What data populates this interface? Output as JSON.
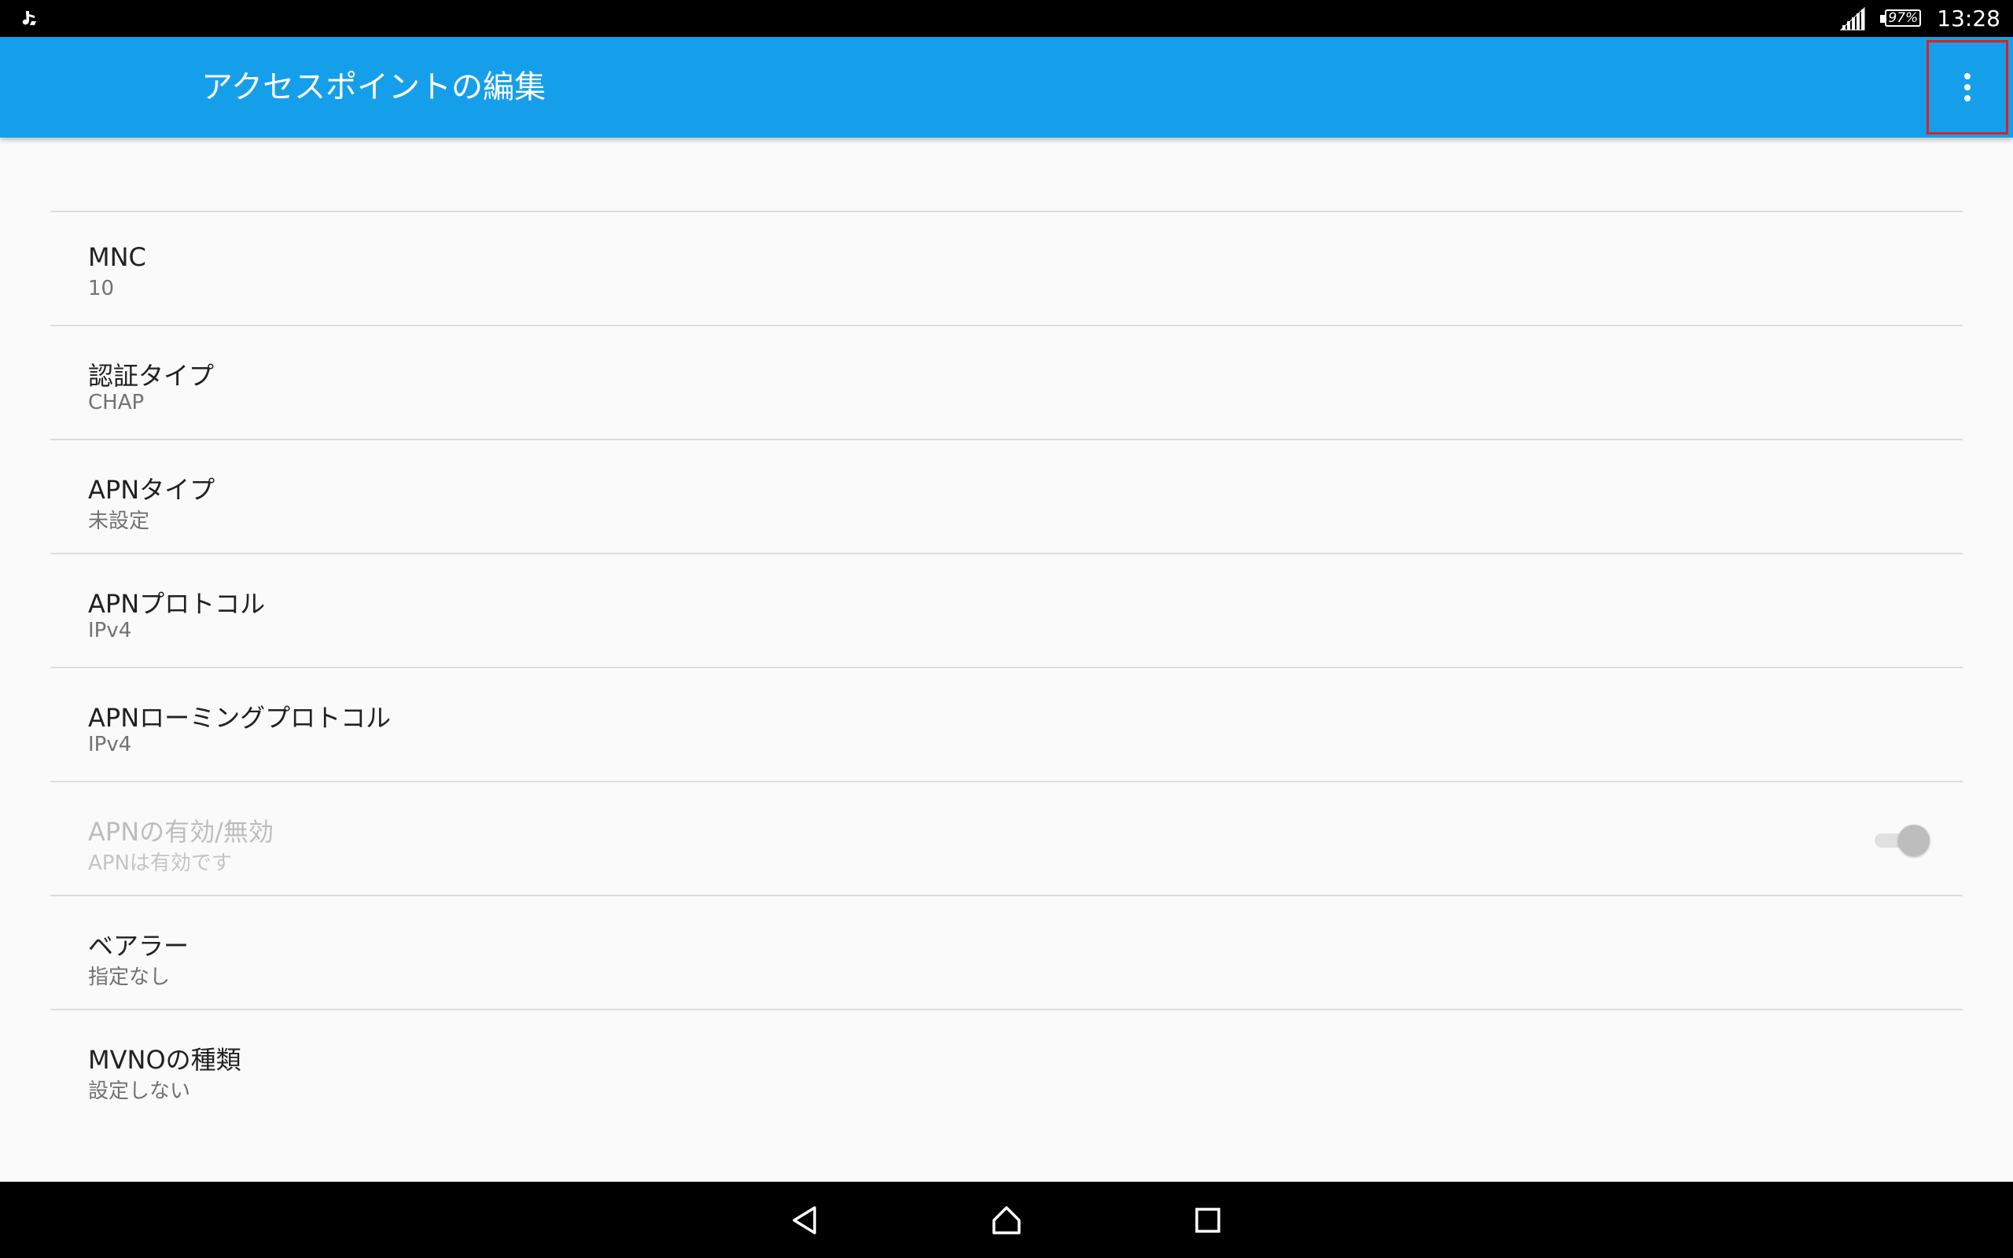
{
  "status_bar": {
    "left_icon": "notification-app-icon",
    "battery_percent": "97%",
    "time": "13:28",
    "signal_icon": "cell-signal-icon"
  },
  "app_bar": {
    "title": "アクセスポイントの編集",
    "overflow_icon": "more-vert-icon",
    "background_color": "#159fea"
  },
  "preferences": [
    {
      "title": "MNC",
      "summary": "10"
    },
    {
      "title": "認証タイプ",
      "summary": "CHAP"
    },
    {
      "title": "APNタイプ",
      "summary": "未設定"
    },
    {
      "title": "APNプロトコル",
      "summary": "IPv4"
    },
    {
      "title": "APNローミングプロトコル",
      "summary": "IPv4"
    },
    {
      "title": "APNの有効/無効",
      "summary": "APNは有効です",
      "enabled": false,
      "switch_on": true
    },
    {
      "title": "ベアラー",
      "summary": "指定なし"
    },
    {
      "title": "MVNOの種類",
      "summary": "設定しない"
    }
  ],
  "nav_bar": {
    "back_icon": "back-triangle-icon",
    "home_icon": "home-icon",
    "recents_icon": "recents-square-icon"
  }
}
